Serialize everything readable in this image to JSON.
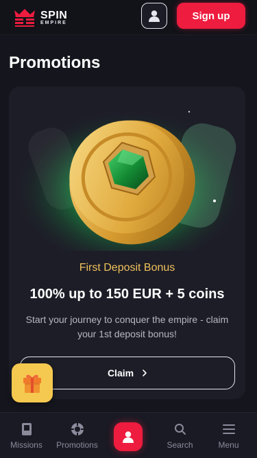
{
  "header": {
    "logo_line1": "SPIN",
    "logo_line2": "EMPIRE",
    "signup_label": "Sign up",
    "accent_color": "#ee1c3e"
  },
  "page": {
    "title": "Promotions"
  },
  "promo": {
    "label": "First Deposit Bonus",
    "title": "100% up to 150 EUR + 5 coins",
    "description": "Start your journey to conquer the empire - claim your 1st deposit bonus!",
    "claim_label": "Claim",
    "image": "gold-coin-with-emerald"
  },
  "gift": {
    "icon": "gift-icon"
  },
  "bottom_nav": {
    "items": [
      {
        "label": "Missions",
        "icon": "book-icon"
      },
      {
        "label": "Promotions",
        "icon": "chip-icon"
      },
      {
        "label": "",
        "icon": "user-icon"
      },
      {
        "label": "Search",
        "icon": "search-icon"
      },
      {
        "label": "Menu",
        "icon": "menu-icon"
      }
    ]
  }
}
